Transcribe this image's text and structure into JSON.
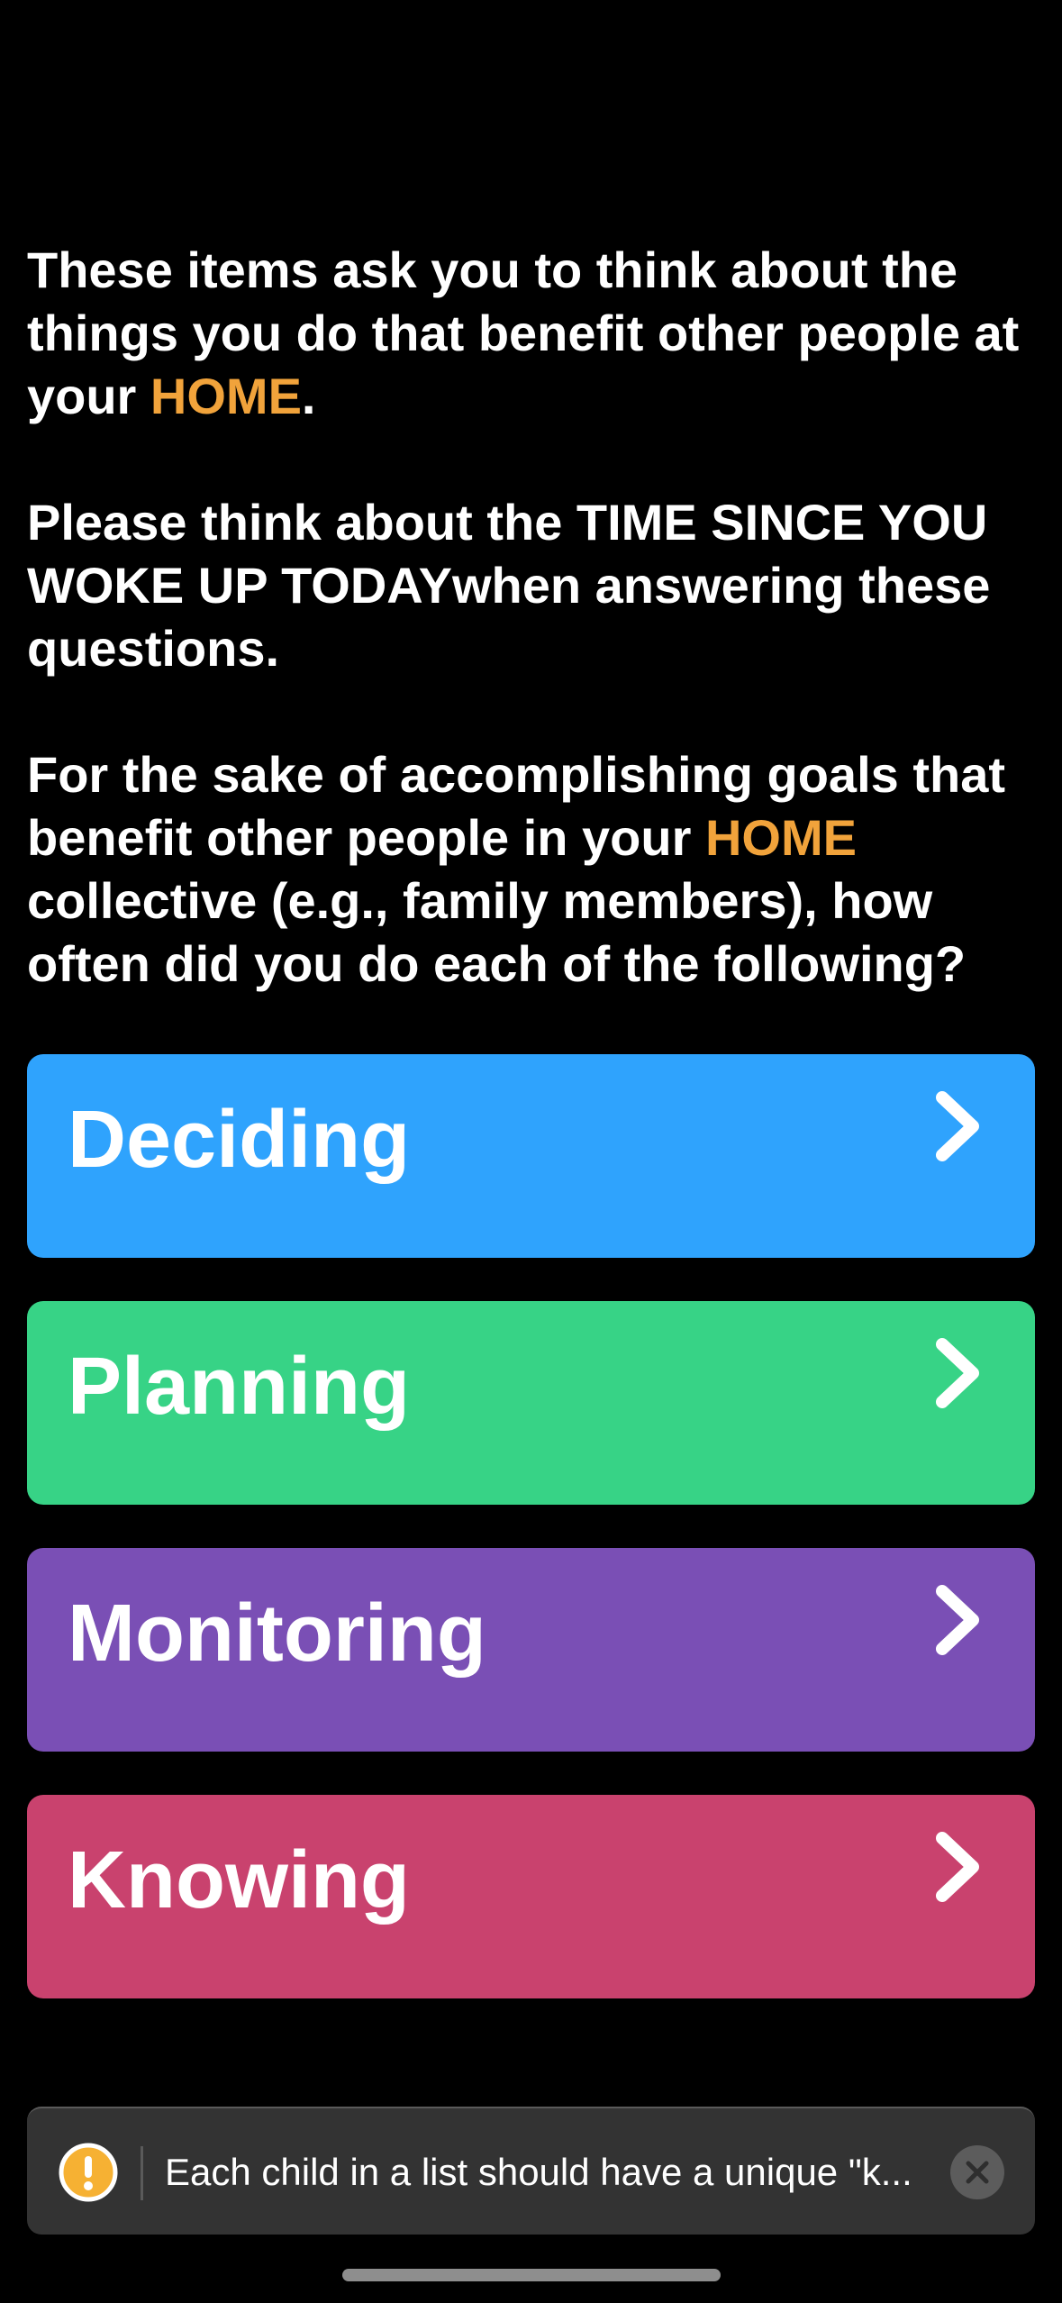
{
  "intro": {
    "p1_before": "These items ask you to think about the things you do that benefit other people at your ",
    "p1_highlight": "HOME",
    "p1_after": ".",
    "p2": "Please think about the TIME SINCE YOU WOKE UP TODAYwhen answering these questions.",
    "p3_before": "For the sake of accomplishing goals that benefit other people in your ",
    "p3_highlight": "HOME",
    "p3_after": " collective (e.g., family members), how often did you do each of the following?"
  },
  "categories": [
    {
      "label": "Deciding",
      "color": "#2fa3fd",
      "icon": "chevron-right-icon"
    },
    {
      "label": "Planning",
      "color": "#37d386",
      "icon": "chevron-right-icon"
    },
    {
      "label": "Monitoring",
      "color": "#7a4fb5",
      "icon": "chevron-right-icon"
    },
    {
      "label": "Knowing",
      "color": "#c9426e",
      "icon": "chevron-right-icon"
    }
  ],
  "toast": {
    "icon": "warning-icon",
    "icon_color": "#f6b133",
    "message": "Each child in a list should have a unique \"k...",
    "dismiss_icon": "close-icon"
  },
  "colors": {
    "background": "#000000",
    "highlight": "#f1a33b",
    "toast_background": "#333333"
  }
}
